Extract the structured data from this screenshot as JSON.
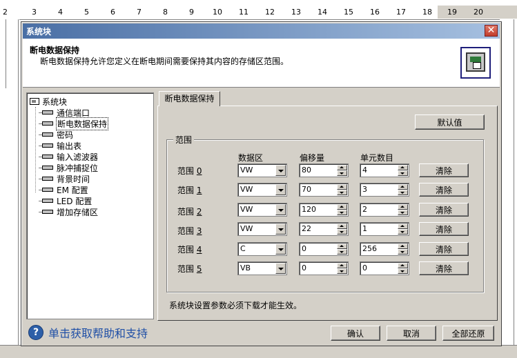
{
  "ruler": {
    "labels": [
      "2",
      "3",
      "4",
      "5",
      "6",
      "7",
      "8",
      "9",
      "10",
      "11",
      "12",
      "13",
      "14",
      "15",
      "16",
      "17",
      "18",
      "19",
      "20"
    ]
  },
  "dialog": {
    "title": "系统块",
    "header_title": "断电数据保持",
    "header_desc": "断电数据保持允许您定义在断电期间需要保持其内容的存储区范围。"
  },
  "tree": {
    "root": "系统块",
    "items": [
      "通信端口",
      "断电数据保持",
      "密码",
      "输出表",
      "输入滤波器",
      "脉冲捕捉位",
      "背景时间",
      "EM 配置",
      "LED 配置",
      "增加存储区"
    ],
    "selected_index": 1
  },
  "tab_label": "断电数据保持",
  "default_button": "默认值",
  "group_label": "范围",
  "columns": {
    "data_area": "数据区",
    "offset": "偏移量",
    "count": "单元数目"
  },
  "row_prefix": "范围",
  "rows": [
    {
      "index": "0",
      "area": "VW",
      "offset": "80",
      "count": "4",
      "clear": "清除"
    },
    {
      "index": "1",
      "area": "VW",
      "offset": "70",
      "count": "3",
      "clear": "清除"
    },
    {
      "index": "2",
      "area": "VW",
      "offset": "120",
      "count": "2",
      "clear": "清除"
    },
    {
      "index": "3",
      "area": "VW",
      "offset": "22",
      "count": "1",
      "clear": "清除"
    },
    {
      "index": "4",
      "area": "C",
      "offset": "0",
      "count": "256",
      "clear": "清除"
    },
    {
      "index": "5",
      "area": "VB",
      "offset": "0",
      "count": "0",
      "clear": "清除"
    }
  ],
  "note": "系统块设置参数必须下载才能生效。",
  "help_text": "单击获取帮助和支持",
  "buttons": {
    "ok": "确认",
    "cancel": "取消",
    "restore_all": "全部还原"
  },
  "icons": {
    "close": "close-icon",
    "help": "help-icon",
    "header": "system-block-icon"
  }
}
